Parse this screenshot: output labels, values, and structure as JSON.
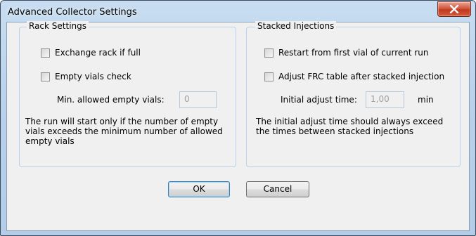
{
  "window": {
    "title": "Advanced Collector Settings"
  },
  "rack_settings": {
    "legend": "Rack Settings",
    "exchange_rack_label": "Exchange rack if full",
    "exchange_rack_checked": false,
    "empty_vials_check_label": "Empty vials check",
    "empty_vials_check_checked": false,
    "min_empty_vials_label": "Min. allowed empty vials:",
    "min_empty_vials_value": "0",
    "note": "The run will start only if the number of empty vials exceeds the minimum number of allowed empty vials"
  },
  "stacked_injections": {
    "legend": "Stacked Injections",
    "restart_first_vial_label": "Restart from first vial of current run",
    "restart_first_vial_checked": false,
    "adjust_frc_label": "Adjust FRC table after stacked injection",
    "adjust_frc_checked": false,
    "initial_adjust_time_label": "Initial adjust time:",
    "initial_adjust_time_value": "1,00",
    "initial_adjust_time_unit": "min",
    "note": "The initial adjust time should always exceed the times between stacked injections"
  },
  "buttons": {
    "ok_label": "OK",
    "cancel_label": "Cancel"
  },
  "colors": {
    "close_button": "#c1391f",
    "group_border": "#b7d2ea",
    "dialog_background": "#f0f0f0"
  },
  "icons": {
    "close": "close-icon"
  }
}
